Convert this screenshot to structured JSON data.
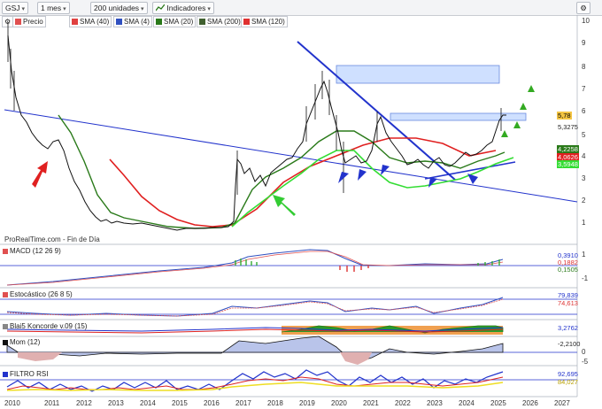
{
  "toolbar": {
    "symbol": "GSJ",
    "period": "1 mes",
    "units": "200 unidades",
    "indicators_label": "Indicadores"
  },
  "legend": [
    {
      "label": "Precio",
      "color": "#e05050"
    },
    {
      "label": "SMA (40)",
      "color": "#e04040"
    },
    {
      "label": "SMA (4)",
      "color": "#3050c0"
    },
    {
      "label": "SMA (20)",
      "color": "#2a7a1a"
    },
    {
      "label": "SMA (200)",
      "color": "#406030"
    },
    {
      "label": "SMA (120)",
      "color": "#e03030"
    }
  ],
  "price_axis": [
    "10",
    "9",
    "8",
    "7",
    "6",
    "5",
    "4",
    "3",
    "2",
    "1"
  ],
  "price_values": {
    "last": "5,78",
    "v2": "5,3275",
    "v3": "4,2258",
    "v4": "4,0626",
    "v5": "3,5948"
  },
  "source_label": "ProRealTime.com - Fin de Día",
  "panels": {
    "macd": {
      "label": "MACD (12 26 9)",
      "axis": [
        "1",
        "-1"
      ],
      "values": [
        "0,3910",
        "0,1882",
        "0,1505"
      ]
    },
    "stoch": {
      "label": "Estocástico (26 8 5)",
      "values": [
        "79,839",
        "74,613"
      ]
    },
    "blai": {
      "label": "Blai5 Koncorde v.09 (15)",
      "values": [
        "3,2762"
      ]
    },
    "mom": {
      "label": "Mom (12)",
      "axis": [
        "0",
        "-5"
      ],
      "values": [
        "-2,2100"
      ]
    },
    "rsi": {
      "label": "FILTRO RSI",
      "values": [
        "92,695",
        "84,027"
      ]
    }
  },
  "years": [
    "2010",
    "2011",
    "2012",
    "2013",
    "2014",
    "2015",
    "2016",
    "2017",
    "2018",
    "2019",
    "2020",
    "2021",
    "2022",
    "2023",
    "2024",
    "2025",
    "2026",
    "2027"
  ],
  "colors": {
    "price": "#111111",
    "sma_green": "#2a7a1a",
    "sma_red": "#e02020",
    "sma_lime": "#33dd33",
    "trend_blue": "#2233cc",
    "accent_box": "#cfe0ff"
  }
}
